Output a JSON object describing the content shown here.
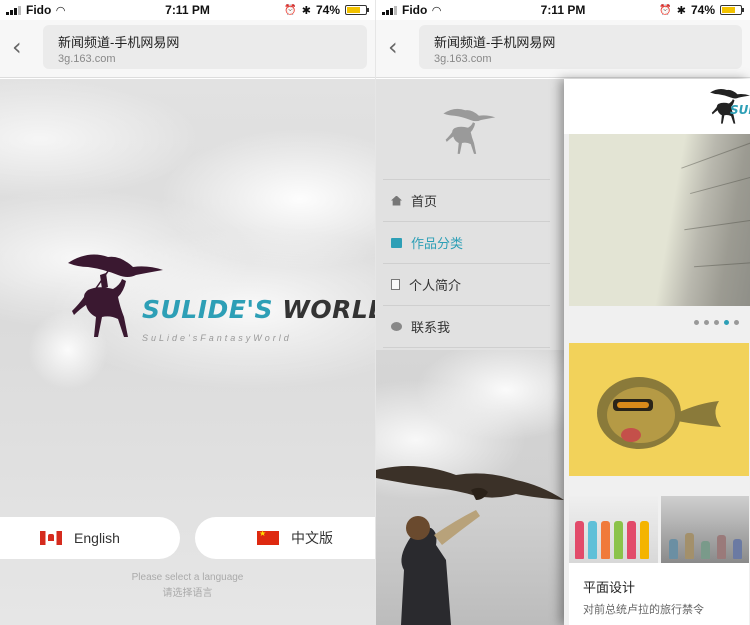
{
  "status_bar": {
    "carrier": "Fido",
    "time": "7:11 PM",
    "battery": "74%"
  },
  "address_bar": {
    "title": "新闻频道-手机网易网",
    "host": "3g.163.com"
  },
  "splash": {
    "logo_name_part1": "SULIDE'S",
    "logo_name_part2": "WORLD",
    "logo_tagline": "SuLide'sFantasyWorld",
    "language_buttons": [
      {
        "label": "English",
        "flag": "canada-flag-icon"
      },
      {
        "label": "中文版",
        "flag": "china-flag-icon"
      }
    ],
    "prompt_en": "Please select a language",
    "prompt_zh": "请选择语言"
  },
  "menu": {
    "items": [
      {
        "label": "首页",
        "icon": "home-icon",
        "active": false
      },
      {
        "label": "作品分类",
        "icon": "folder-icon",
        "active": true
      },
      {
        "label": "个人简介",
        "icon": "document-icon",
        "active": false
      },
      {
        "label": "联系我",
        "icon": "chat-icon",
        "active": false
      }
    ]
  },
  "main_page": {
    "logo_text": "SULI",
    "carousel": {
      "slide_count": 5,
      "active_index": 3
    },
    "featured_card": {
      "title": "平面设计",
      "description": "对前总统卢拉的旅行禁令"
    }
  },
  "colors": {
    "accent": "#2d9fb6",
    "logo_dark": "#333333",
    "emblem": "#3a1830"
  }
}
